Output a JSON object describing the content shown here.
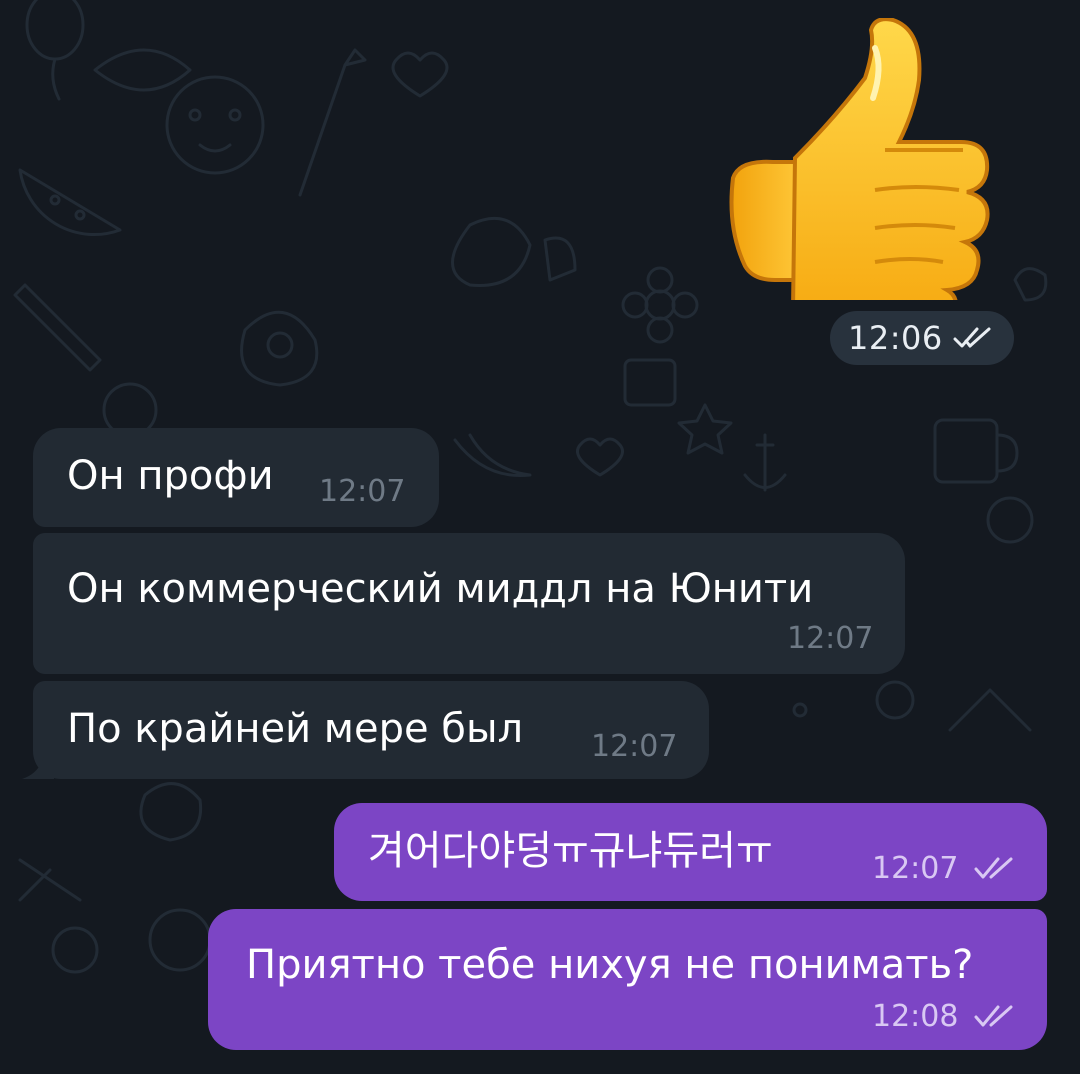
{
  "sticker": {
    "emoji_name": "thumbs-up",
    "time": "12:06",
    "status": "read"
  },
  "messages": [
    {
      "direction": "incoming",
      "text": "Он профи",
      "time": "12:07"
    },
    {
      "direction": "incoming",
      "text": "Он коммерческий миддл на Юнити",
      "time": "12:07"
    },
    {
      "direction": "incoming",
      "text": "По крайней мере был",
      "time": "12:07"
    },
    {
      "direction": "outgoing",
      "text": "겨어다야덩ㅠ규냐듀러ㅠ",
      "time": "12:07",
      "status": "read"
    },
    {
      "direction": "outgoing",
      "text": "Приятно тебе нихуя не понимать?",
      "time": "12:08",
      "status": "read"
    }
  ],
  "colors": {
    "background": "#141920",
    "incoming_bubble": "#222a33",
    "outgoing_bubble": "#7c45c5",
    "pattern": "#1f2731"
  }
}
